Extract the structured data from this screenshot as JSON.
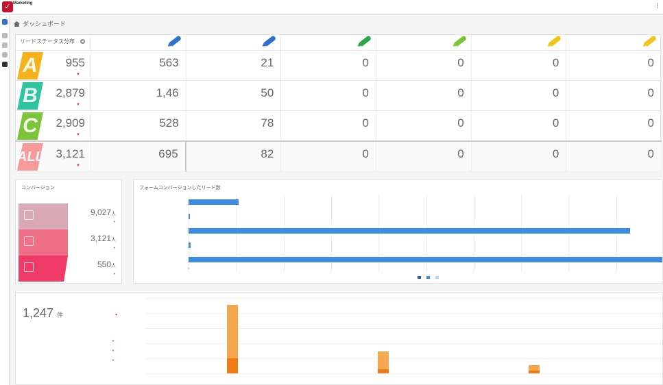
{
  "app": {
    "title": "Marketing",
    "top_right": "⋮"
  },
  "breadcrumb": {
    "label": "ダッシュボード"
  },
  "lead_table": {
    "title": "リードステータス分布",
    "column_labels": [
      "",
      "",
      "",
      "",
      "",
      "",
      ""
    ],
    "columns_pen_colors": [
      "#2f6fce",
      "#2f6fce",
      "#2aa84a",
      "#7cc43a",
      "#f0c419",
      "#f0c419"
    ],
    "rows": [
      {
        "badge": "A",
        "color": "#f6b21b",
        "sub": "",
        "total": "955",
        "foot": "",
        "delta": "▼",
        "cells": [
          "563",
          "21",
          "0",
          "0",
          "0",
          "0"
        ]
      },
      {
        "badge": "B",
        "color": "#2ec4a0",
        "sub": "",
        "total": "2,879",
        "foot": "",
        "delta": "▼",
        "cells": [
          "1,46",
          "50",
          "0",
          "0",
          "0",
          "0"
        ]
      },
      {
        "badge": "C",
        "color": "#7cc43a",
        "sub": "",
        "total": "2,909",
        "foot": "",
        "delta": "▼",
        "cells": [
          "528",
          "78",
          "0",
          "0",
          "0",
          "0"
        ]
      },
      {
        "badge": "ALL",
        "color": "#f69a9a",
        "sub": "",
        "total": "3,121",
        "foot": "",
        "delta": "▼",
        "cells": [
          "695",
          "82",
          "0",
          "0",
          "0",
          "0"
        ]
      }
    ]
  },
  "funnel": {
    "title": "コンバージョン",
    "steps": [
      {
        "label": "",
        "value": "9,027",
        "unit": "人",
        "color": "#d9a9b6",
        "delta": "▼"
      },
      {
        "label": "",
        "value": "3,121",
        "unit": "人",
        "color": "#ef6f86",
        "delta": "▼"
      },
      {
        "label": "",
        "value": "550",
        "unit": "人",
        "color": "#ef3a67",
        "delta": "▼"
      }
    ]
  },
  "form_chart": {
    "title": "フォームコンバージョンしたリード数",
    "chart_data": {
      "type": "bar",
      "orientation": "horizontal",
      "categories": [
        "",
        "",
        "",
        "",
        ""
      ],
      "values": [
        10.5,
        0.2,
        93,
        0.4,
        100
      ],
      "value_labels": [
        "",
        "",
        "",
        "",
        ""
      ],
      "xlim": [
        0,
        100
      ],
      "x_ticks": [
        "0",
        "",
        "",
        "",
        "",
        "",
        "",
        "",
        "",
        "",
        ""
      ],
      "series": [
        {
          "name": "",
          "values": [
            10.5,
            0.2,
            93,
            0.4,
            100
          ]
        }
      ],
      "legend": [
        "",
        "",
        ""
      ],
      "legend_colors": [
        "#2a5fc0",
        "#3c8be5",
        "#bcd4f0"
      ]
    }
  },
  "bottom": {
    "title": "",
    "big_value": "1,247",
    "big_unit": "件",
    "delta": "▼",
    "table": {
      "headers": [
        "",
        "",
        ""
      ],
      "rows": [
        [
          "",
          "",
          "▼"
        ],
        [
          "",
          "",
          "▼"
        ],
        [
          "",
          "",
          "▼"
        ]
      ]
    },
    "chart_data": {
      "type": "bar",
      "stacked": true,
      "categories": [
        "",
        "",
        ""
      ],
      "series": [
        {
          "name": "",
          "color": "#f07a14",
          "values": [
            22,
            6,
            4
          ]
        },
        {
          "name": "",
          "color": "#f8a84c",
          "values": [
            78,
            26,
            8
          ]
        }
      ],
      "ylim": [
        0,
        110
      ],
      "y_ticks": [
        "",
        "",
        "",
        "",
        "",
        ""
      ],
      "legend": [
        "",
        ""
      ]
    }
  }
}
